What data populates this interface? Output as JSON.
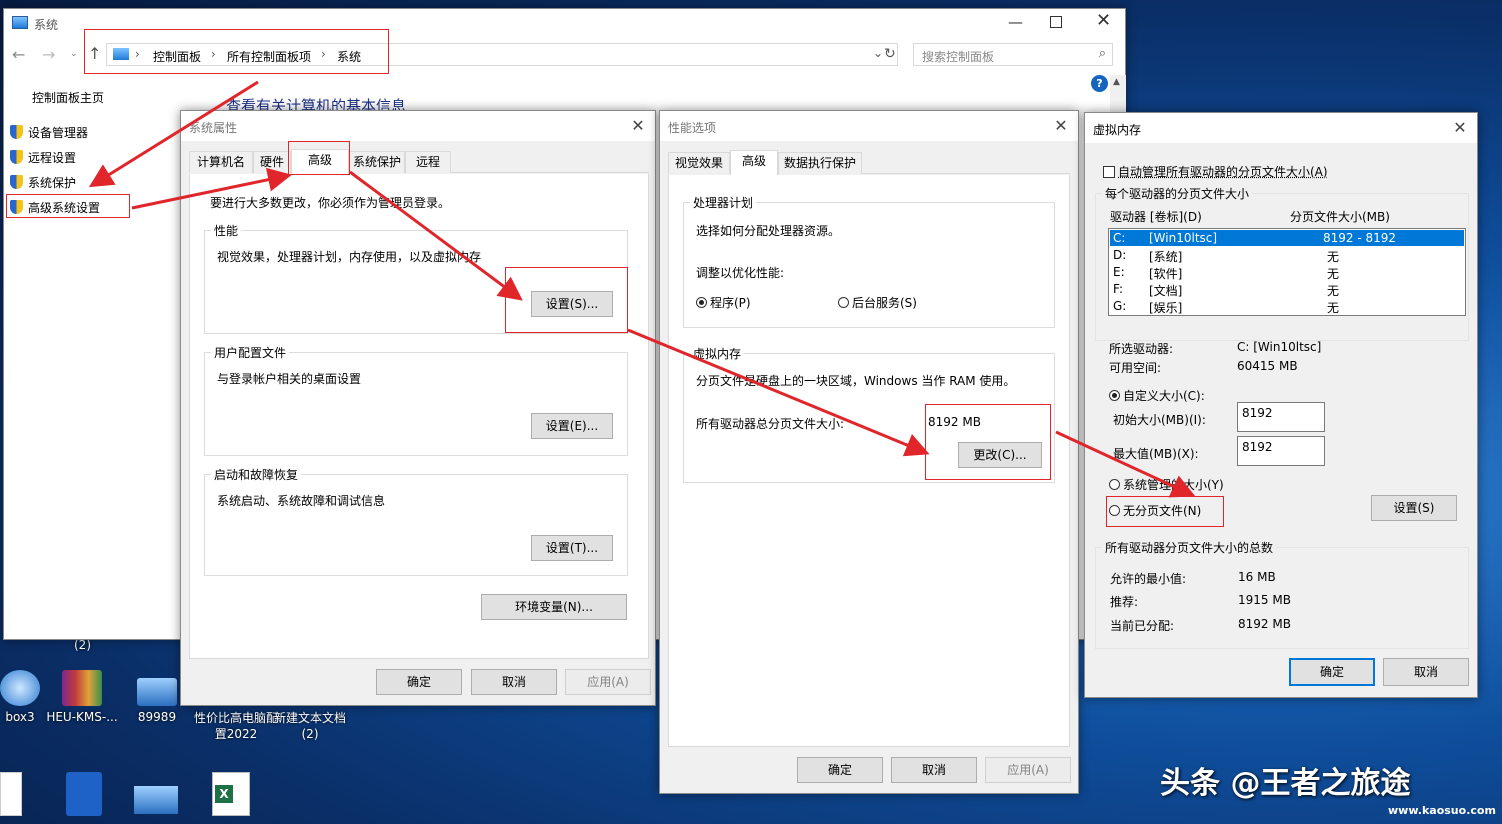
{
  "control_panel": {
    "title": "系统",
    "breadcrumb": [
      "控制面板",
      "所有控制面板项",
      "系统"
    ],
    "search_placeholder": "搜索控制面板",
    "sidebar_home": "控制面板主页",
    "sidebar_items": [
      "设备管理器",
      "远程设置",
      "系统保护",
      "高级系统设置"
    ],
    "heading": "查看有关计算机的基本信息"
  },
  "sys_props": {
    "title": "系统属性",
    "tabs": [
      "计算机名",
      "硬件",
      "高级",
      "系统保护",
      "远程"
    ],
    "admin_note": "要进行大多数更改，你必须作为管理员登录。",
    "perf_label": "性能",
    "perf_desc": "视觉效果，处理器计划，内存使用，以及虚拟内存",
    "perf_btn": "设置(S)...",
    "profile_label": "用户配置文件",
    "profile_desc": "与登录帐户相关的桌面设置",
    "profile_btn": "设置(E)...",
    "startup_label": "启动和故障恢复",
    "startup_desc": "系统启动、系统故障和调试信息",
    "startup_btn": "设置(T)...",
    "env_btn": "环境变量(N)...",
    "ok": "确定",
    "cancel": "取消",
    "apply": "应用(A)"
  },
  "perf_opts": {
    "title": "性能选项",
    "tabs": [
      "视觉效果",
      "高级",
      "数据执行保护"
    ],
    "cpu_label": "处理器计划",
    "cpu_desc": "选择如何分配处理器资源。",
    "optimize_label": "调整以优化性能:",
    "radio_programs": "程序(P)",
    "radio_background": "后台服务(S)",
    "vm_label": "虚拟内存",
    "vm_desc": "分页文件是硬盘上的一块区域，Windows 当作 RAM 使用。",
    "vm_total_label": "所有驱动器总分页文件大小:",
    "vm_total_value": "8192 MB",
    "change_btn": "更改(C)...",
    "ok": "确定",
    "cancel": "取消",
    "apply": "应用(A)"
  },
  "vmem": {
    "title": "虚拟内存",
    "auto_manage": "自动管理所有驱动器的分页文件大小(A)",
    "per_drive_label": "每个驱动器的分页文件大小",
    "col_drive": "驱动器 [卷标](D)",
    "col_size": "分页文件大小(MB)",
    "drives": [
      {
        "drive": "C:",
        "label": "[Win10ltsc]",
        "size": "8192 - 8192"
      },
      {
        "drive": "D:",
        "label": "[系统]",
        "size": "无"
      },
      {
        "drive": "E:",
        "label": "[软件]",
        "size": "无"
      },
      {
        "drive": "F:",
        "label": "[文档]",
        "size": "无"
      },
      {
        "drive": "G:",
        "label": "[娱乐]",
        "size": "无"
      }
    ],
    "selected_label": "所选驱动器:",
    "selected_value": "C:  [Win10ltsc]",
    "free_label": "可用空间:",
    "free_value": "60415 MB",
    "custom_size": "自定义大小(C):",
    "initial_label": "初始大小(MB)(I):",
    "initial_value": "8192",
    "max_label": "最大值(MB)(X):",
    "max_value": "8192",
    "system_managed": "系统管理的大小(Y)",
    "no_paging": "无分页文件(N)",
    "set_btn": "设置(S)",
    "total_label": "所有驱动器分页文件大小的总数",
    "min_label": "允许的最小值:",
    "min_value": "16 MB",
    "recommended_label": "推荐:",
    "recommended_value": "1915 MB",
    "current_label": "当前已分配:",
    "current_value": "8192 MB",
    "ok": "确定",
    "cancel": "取消"
  },
  "desktop": {
    "icons": [
      "box3",
      "HEU-KMS-...",
      "89989",
      "性价比高电脑配置2022",
      "新建文本文档 (2)"
    ],
    "partial_label": "(2)"
  },
  "watermark": {
    "text": "头条 @王者之旅途",
    "site": "www.kaosuo.com"
  },
  "colors": {
    "accent": "#0078d7",
    "highlight": "#e0262b",
    "selected_row": "#0078d7"
  }
}
